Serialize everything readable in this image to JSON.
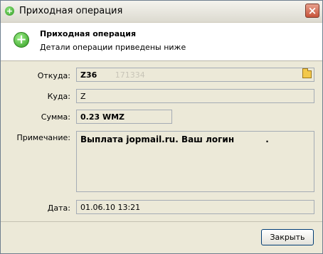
{
  "window": {
    "title": "Приходная операция",
    "close_icon": "×",
    "title_icon": "+"
  },
  "header": {
    "title": "Приходная операция",
    "subtitle": "Детали операции приведены ниже",
    "icon": "+"
  },
  "form": {
    "from": {
      "label": "Откуда:",
      "value_visible": "Z36",
      "value_hidden": "171334",
      "icon": "folder-icon"
    },
    "to": {
      "label": "Куда:",
      "value_visible": "Z",
      "value_hidden": ""
    },
    "amount": {
      "label": "Сумма:",
      "value": "0.23 WMZ"
    },
    "note": {
      "label": "Примечание:",
      "value": "Выплата jopmail.ru. Ваш логин",
      "value_tail": "."
    },
    "date": {
      "label": "Дата:",
      "value": "01.06.10 13:21"
    }
  },
  "footer": {
    "close_label": "Закрыть"
  },
  "colors": {
    "window_bg": "#ece9d8",
    "header_bg": "#ffffff",
    "button_border": "#003c74",
    "close_button": "#c7533a",
    "success_icon": "#2e9a1f"
  }
}
